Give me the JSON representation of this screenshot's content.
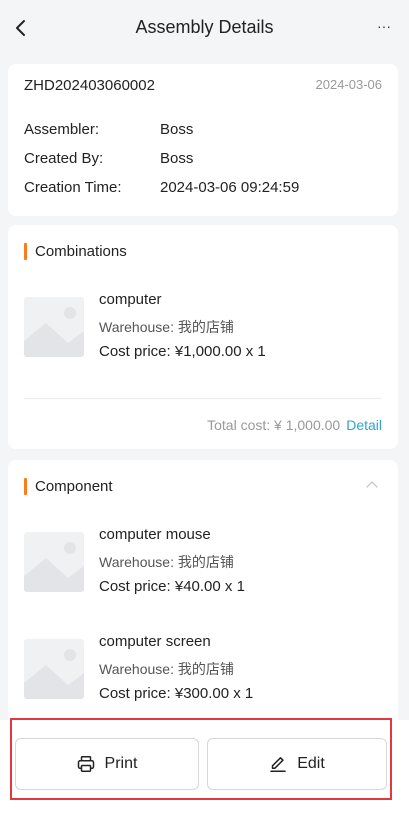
{
  "header": {
    "title": "Assembly Details",
    "back_icon": "chevron-left-icon",
    "more_label": "···"
  },
  "info": {
    "order_no": "ZHD202403060002",
    "date": "2024-03-06",
    "rows": [
      {
        "label": "Assembler:",
        "value": "Boss"
      },
      {
        "label": "Created By:",
        "value": "Boss"
      },
      {
        "label": "Creation Time:",
        "value": "2024-03-06 09:24:59"
      }
    ]
  },
  "combinations": {
    "title": "Combinations",
    "items": [
      {
        "name": "computer",
        "warehouse": "Warehouse: 我的店铺",
        "cost": "Cost price: ¥1,000.00 x 1"
      }
    ],
    "total_label": "Total cost: ¥ 1,000.00",
    "detail_label": "Detail"
  },
  "component": {
    "title": "Component",
    "items": [
      {
        "name": "computer mouse",
        "warehouse": "Warehouse: 我的店铺",
        "cost": "Cost price: ¥40.00 x 1"
      },
      {
        "name": "computer screen",
        "warehouse": "Warehouse: 我的店铺",
        "cost": "Cost price: ¥300.00 x 1"
      }
    ]
  },
  "actions": {
    "print_label": "Print",
    "edit_label": "Edit"
  },
  "colors": {
    "accent": "#ff7a1a",
    "link": "#2aa7c9",
    "highlight": "#e0393e"
  }
}
